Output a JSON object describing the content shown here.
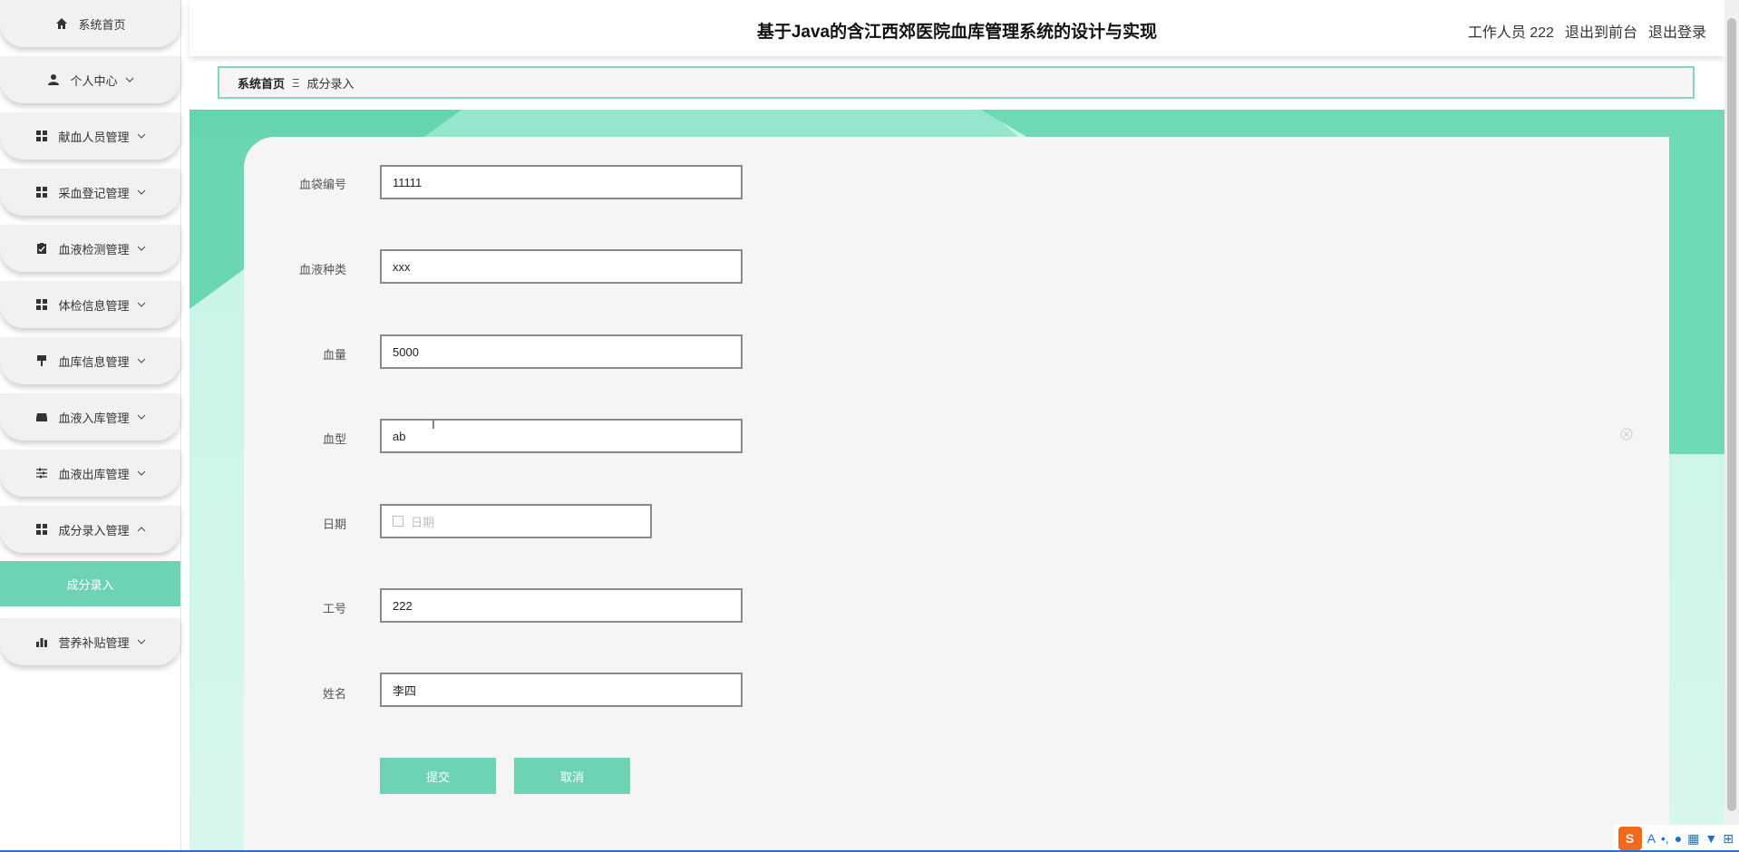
{
  "header": {
    "title": "基于Java的含江西郊医院血库管理系统的设计与实现",
    "user": "工作人员 222",
    "to_front": "退出到前台",
    "logout": "退出登录"
  },
  "breadcrumb": {
    "home": "系统首页",
    "separator": "Ξ",
    "current": "成分录入"
  },
  "sidebar": {
    "items": [
      {
        "label": "系统首页",
        "icon": "home-icon"
      },
      {
        "label": "个人中心",
        "icon": "user-icon"
      },
      {
        "label": "献血人员管理",
        "icon": "grid-icon"
      },
      {
        "label": "采血登记管理",
        "icon": "grid-icon"
      },
      {
        "label": "血液检测管理",
        "icon": "clipboard-icon"
      },
      {
        "label": "体检信息管理",
        "icon": "grid-icon"
      },
      {
        "label": "血库信息管理",
        "icon": "brush-icon"
      },
      {
        "label": "血液入库管理",
        "icon": "inbox-icon"
      },
      {
        "label": "血液出库管理",
        "icon": "sliders-icon"
      },
      {
        "label": "成分录入管理",
        "icon": "grid-icon"
      },
      {
        "label": "营养补贴管理",
        "icon": "bar-chart-icon"
      }
    ],
    "active_sub": "成分录入"
  },
  "form": {
    "bag_no": {
      "label": "血袋编号",
      "value": "11111"
    },
    "blood_kind": {
      "label": "血液种类",
      "value": "xxx"
    },
    "volume": {
      "label": "血量",
      "value": "5000"
    },
    "blood_type": {
      "label": "血型",
      "value": "ab"
    },
    "date": {
      "label": "日期",
      "placeholder": "日期"
    },
    "work_no": {
      "label": "工号",
      "value": "222"
    },
    "name": {
      "label": "姓名",
      "value": "李四"
    },
    "submit": "提交",
    "cancel": "取消"
  },
  "colors": {
    "accent": "#6ed3b4",
    "border": "#7ad8bb"
  }
}
